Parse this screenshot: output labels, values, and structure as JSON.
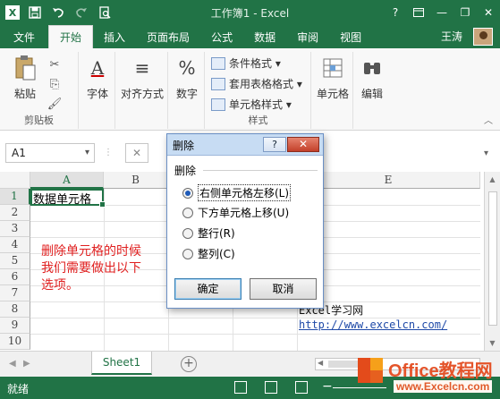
{
  "titlebar": {
    "title": "工作簿1 - Excel",
    "logo": "X",
    "icons": [
      "excel-logo-icon",
      "save-icon",
      "undo-icon",
      "redo-icon",
      "print-preview-icon",
      "help-icon",
      "ribbon-options-icon",
      "minimize-icon",
      "restore-icon",
      "close-icon"
    ],
    "help_glyph": "?",
    "minimize_glyph": "—",
    "restore_glyph": "❐",
    "close_glyph": "✕"
  },
  "tabs": {
    "file": "文件",
    "items": [
      "开始",
      "插入",
      "页面布局",
      "公式",
      "数据",
      "审阅",
      "视图"
    ],
    "active_index": 0,
    "user": "王涛"
  },
  "ribbon": {
    "clipboard": {
      "paste": "粘贴",
      "group_label": "剪贴板"
    },
    "font": {
      "label": "字体",
      "icon_glyph": "A"
    },
    "alignment": {
      "label": "对齐方式",
      "icon_glyph": "≡"
    },
    "number": {
      "label": "数字",
      "icon_glyph": "%"
    },
    "styles": {
      "items": [
        "条件格式",
        "套用表格格式",
        "单元格样式"
      ],
      "group_label": "样式"
    },
    "cells": {
      "label": "单元格"
    },
    "editing": {
      "label": "编辑"
    }
  },
  "formula_bar": {
    "name_box": "A1",
    "fx_cancel": "✕"
  },
  "grid": {
    "columns": [
      "A",
      "B",
      "C",
      "D",
      "E"
    ],
    "selected_column": "A",
    "rows": [
      "1",
      "2",
      "3",
      "4",
      "5",
      "6",
      "7",
      "8",
      "9",
      "10"
    ],
    "selected_row": "1",
    "a1_value": "数据单元格",
    "annotation": [
      "删除单元格的时候",
      "我们需要做出以下",
      "选项。"
    ],
    "d8_value": "Excel学习网",
    "d9_value": "http://www.excelcn.com/"
  },
  "sheets": {
    "tabs": [
      "Sheet1"
    ],
    "add_glyph": "+"
  },
  "status": {
    "text": "就绪",
    "zoom_minus": "−"
  },
  "watermark": {
    "title": "Office教程网",
    "url": "www.Excelcn.com"
  },
  "dialog": {
    "title": "删除",
    "help": "?",
    "close": "✕",
    "group_label": "删除",
    "options": [
      "右侧单元格左移(L)",
      "下方单元格上移(U)",
      "整行(R)",
      "整列(C)"
    ],
    "selected_index": 0,
    "ok": "确定",
    "cancel": "取消"
  },
  "colors": {
    "excel_green": "#217346",
    "annotation_red": "#e02020",
    "link_blue": "#1f4aa8",
    "dialog_title_bg": "#c7dcf3",
    "close_red": "#c3402a"
  }
}
